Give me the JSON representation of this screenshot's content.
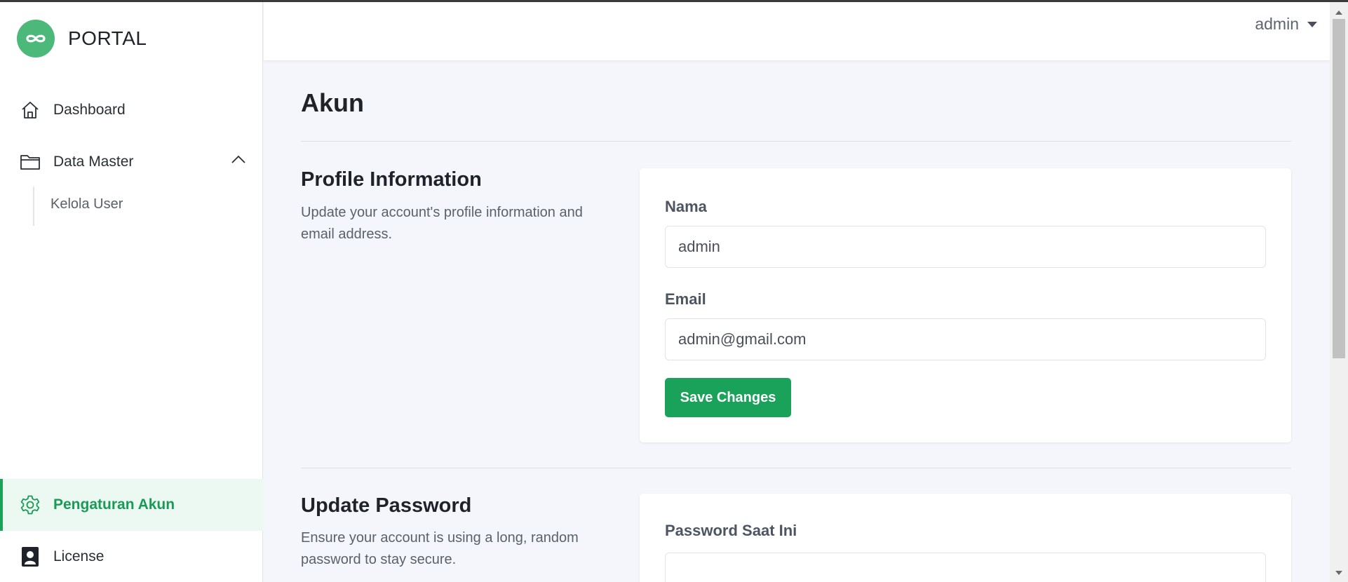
{
  "app": {
    "brand": "PORTAL"
  },
  "sidebar": {
    "items": [
      {
        "label": "Dashboard",
        "icon": "home-icon"
      },
      {
        "label": "Data Master",
        "icon": "folder-icon",
        "expanded": true,
        "children": [
          {
            "label": "Kelola User"
          }
        ]
      }
    ],
    "bottom_items": [
      {
        "label": "Pengaturan Akun",
        "icon": "gear-icon",
        "active": true
      },
      {
        "label": "License",
        "icon": "id-badge-icon"
      }
    ]
  },
  "header": {
    "user": "admin"
  },
  "page": {
    "title": "Akun"
  },
  "profile": {
    "title": "Profile Information",
    "description": "Update your account's profile information and email address.",
    "name_label": "Nama",
    "name_value": "admin",
    "email_label": "Email",
    "email_value": "admin@gmail.com",
    "save_label": "Save Changes"
  },
  "password": {
    "title": "Update Password",
    "description": "Ensure your account is using a long, random password to stay secure.",
    "current_label": "Password Saat Ini",
    "current_value": ""
  },
  "colors": {
    "accent": "#1aa15a",
    "brand_logo": "#4cb87a",
    "active_bg": "#ecf9f2",
    "page_bg": "#f5f6fc"
  }
}
